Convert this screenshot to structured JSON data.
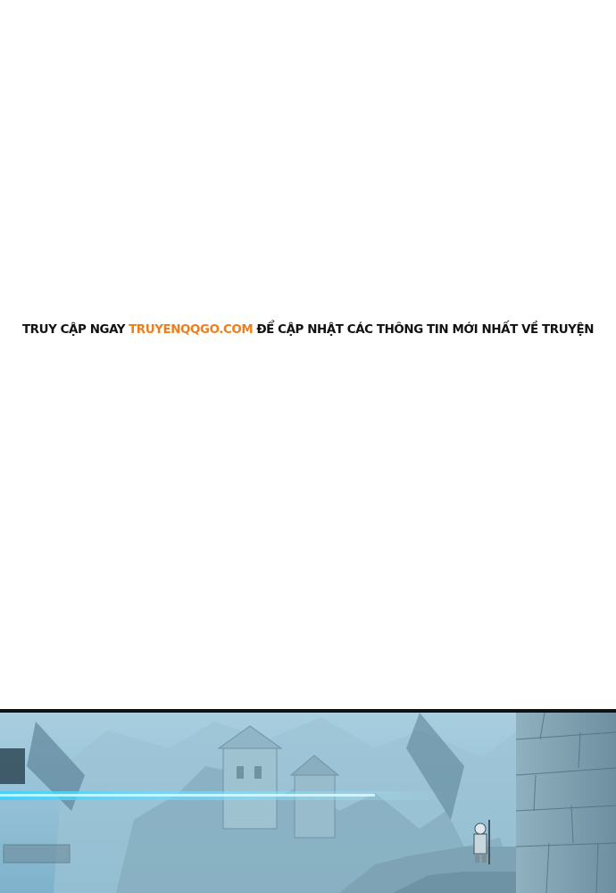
{
  "notice": {
    "prefix": "TRUY CẬP NGAY",
    "link": "TRUYENQQGO.COM",
    "suffix": "ĐỂ CẬP NHẬT CÁC THÔNG TIN MỚI NHẤT VỀ TRUYỆN",
    "link_color": "#f07d1a",
    "text_color": "#111111"
  },
  "comic_panel": {
    "description_icon": "castle-ruins-illustration"
  }
}
